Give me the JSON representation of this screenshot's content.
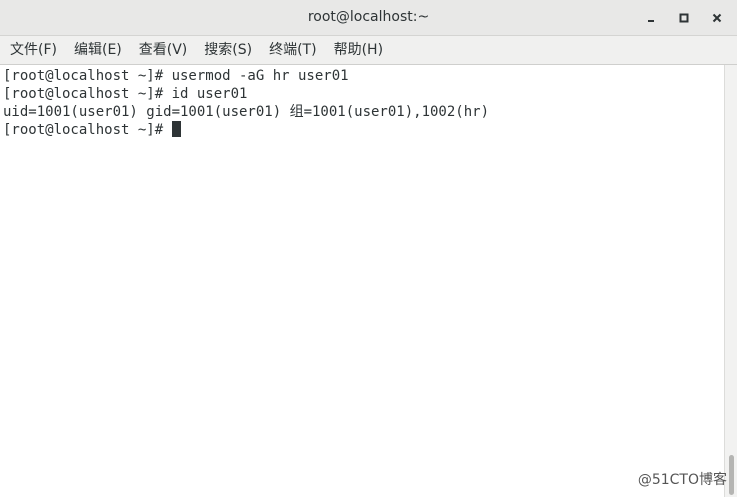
{
  "window": {
    "title": "root@localhost:~"
  },
  "menu": [
    "文件(F)",
    "编辑(E)",
    "查看(V)",
    "搜索(S)",
    "终端(T)",
    "帮助(H)"
  ],
  "terminal": {
    "lines": [
      "[root@localhost ~]# usermod -aG hr user01",
      "[root@localhost ~]# id user01",
      "uid=1001(user01) gid=1001(user01) 组=1001(user01),1002(hr)",
      "[root@localhost ~]# "
    ]
  },
  "watermark": "@51CTO博客",
  "icons": {
    "minimize": "minimize-icon",
    "maximize": "maximize-icon",
    "close": "close-icon"
  }
}
